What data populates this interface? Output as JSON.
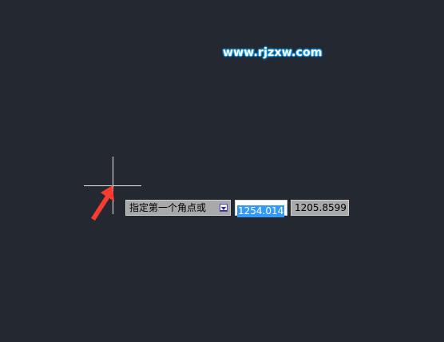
{
  "watermark": {
    "text": "www.rjzxw.com",
    "color": "#ffffff",
    "glow_color": "#1da7ff"
  },
  "canvas": {
    "background": "#232831",
    "crosshair_color": "#e8e8e8"
  },
  "annotation_arrow": {
    "color": "#ff3b30"
  },
  "dynamic_input": {
    "prompt_label": "指定第一个角点或",
    "options_icon": "dropdown-options-icon",
    "x_value": "1254.014",
    "y_value": "1205.8599",
    "selection_color": "#3399ff"
  }
}
